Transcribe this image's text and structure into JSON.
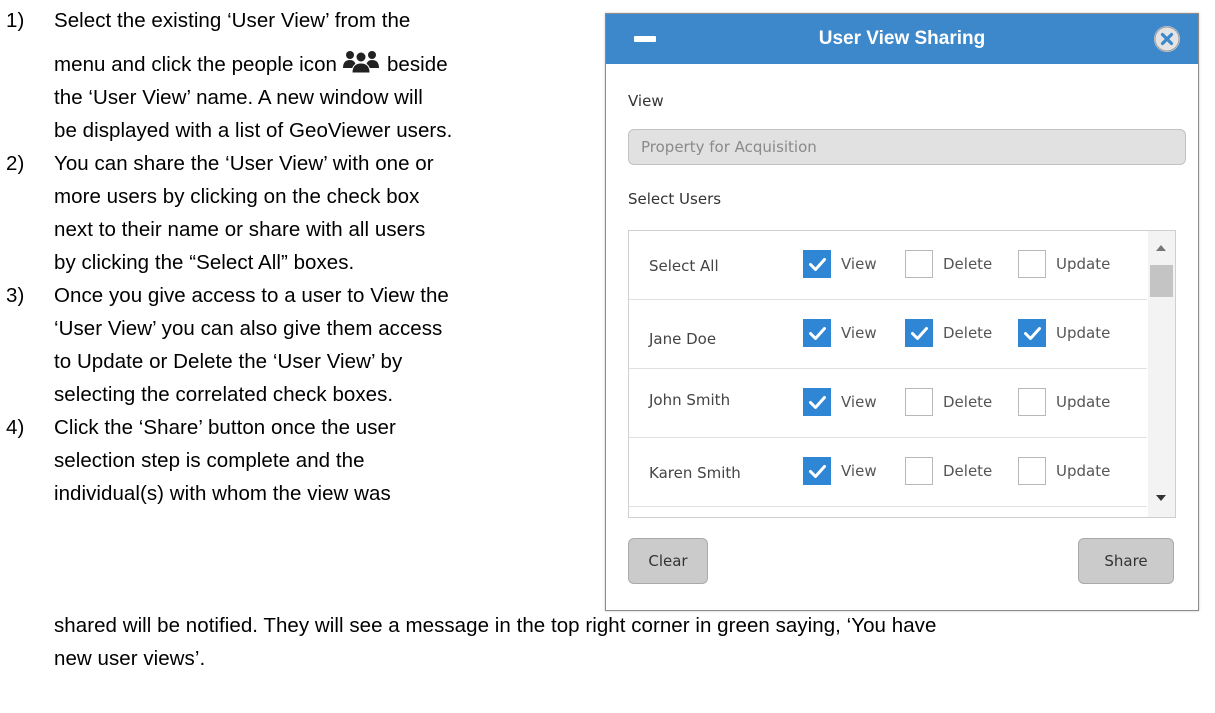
{
  "instructions": {
    "steps": [
      {
        "number": "1)",
        "lines": [
          "Select the existing ‘User View’ from the",
          "menu and click the people icon",
          "beside",
          "the ‘User View’ name. A new window will",
          "be displayed with a list of GeoViewer users."
        ]
      },
      {
        "number": "2)",
        "lines": [
          "You can share the ‘User View’ with one or",
          "more users by clicking on the check box",
          "next to their name or share with all users",
          "by clicking the “Select All” boxes."
        ]
      },
      {
        "number": "3)",
        "lines": [
          "Once you give access to a user to View the",
          "‘User View’ you can also give them access",
          "to Update or Delete the ‘User View’ by",
          "selecting the correlated check boxes."
        ]
      },
      {
        "number": "4)",
        "lines": [
          "Click the ‘Share’ button once the user",
          "selection step is complete and the",
          "individual(s) with whom the view was"
        ]
      }
    ],
    "continuation": [
      "shared will be notified. They will see a message in the top right corner in green saying, ‘You have",
      "new user views’."
    ],
    "people_icon": "people-group-icon"
  },
  "dialog": {
    "title": "User View Sharing",
    "minimize_icon": "minus-icon",
    "close_icon": "close-circle-icon",
    "view_label": "View",
    "view_value": "Property for Acquisition",
    "select_users_label": "Select Users",
    "permission_labels": {
      "view": "View",
      "delete": "Delete",
      "update": "Update"
    },
    "users": [
      {
        "name": "Select All",
        "view": true,
        "delete": false,
        "update": false
      },
      {
        "name": "Jane Doe",
        "view": true,
        "delete": true,
        "update": true
      },
      {
        "name": "John Smith",
        "view": true,
        "delete": false,
        "update": false
      },
      {
        "name": "Karen Smith",
        "view": true,
        "delete": false,
        "update": false
      }
    ],
    "clear_label": "Clear",
    "share_label": "Share",
    "colors": {
      "titlebar": "#3d87cb",
      "checkbox_checked": "#2f86d4"
    }
  }
}
